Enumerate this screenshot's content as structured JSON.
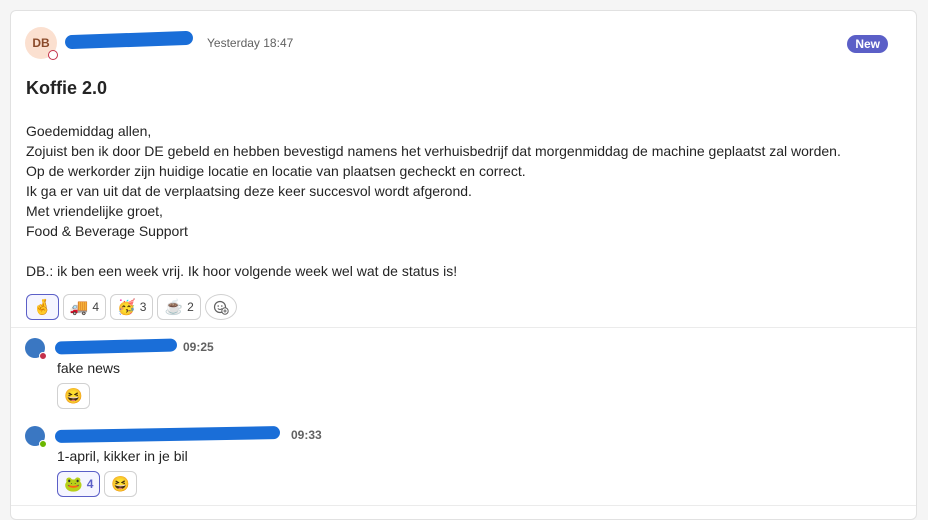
{
  "post": {
    "author_initials": "DB",
    "timestamp": "Yesterday 18:47",
    "badge": "New",
    "subject": "Koffie 2.0",
    "body_lines": [
      "Goedemiddag allen,",
      "Zojuist ben ik door DE gebeld en hebben bevestigd namens het verhuisbedrijf dat morgenmiddag de machine geplaatst zal worden.",
      "Op de werkorder zijn huidige locatie en locatie van plaatsen gecheckt en correct.",
      "Ik ga er van uit dat de verplaatsing deze keer succesvol wordt afgerond.",
      "Met vriendelijke groet,",
      "Food & Beverage Support",
      "",
      "DB.: ik ben een week vrij. Ik hoor volgende week wel wat de status is!"
    ],
    "reactions": [
      {
        "emoji": "🤞",
        "icon": "crossed-fingers-icon",
        "count": ""
      },
      {
        "emoji": "🚚",
        "icon": "delivery-truck-icon",
        "count": "4"
      },
      {
        "emoji": "🥳",
        "icon": "party-face-icon",
        "count": "3"
      },
      {
        "emoji": "☕",
        "icon": "coffee-icon",
        "count": "2"
      }
    ],
    "add_reaction_icon": "add-reaction-icon"
  },
  "replies": [
    {
      "time": "09:25",
      "text": "fake news",
      "presence_color": "#c4314b",
      "reactions": [
        {
          "emoji": "😆",
          "icon": "laughing-face-icon",
          "count": ""
        }
      ]
    },
    {
      "time": "09:33",
      "text": "1-april, kikker in je bil",
      "presence_color": "#6bb700",
      "reactions": [
        {
          "emoji": "🐸",
          "icon": "frog-icon",
          "count": "4"
        },
        {
          "emoji": "😆",
          "icon": "laughing-face-icon",
          "count": ""
        }
      ]
    }
  ],
  "colors": {
    "accent": "#5b5fc7",
    "redaction": "#1a6ed8"
  }
}
